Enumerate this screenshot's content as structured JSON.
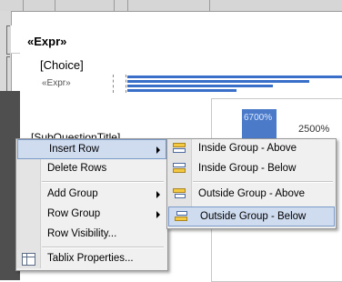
{
  "report": {
    "expr_header": "«Expr»",
    "choice_cell": "[Choice]",
    "detail_expr": "«Expr»",
    "subquestion_title": "[SubQuestionTitle]",
    "chart_label_1": "6700%",
    "chart_label_2": "2500%"
  },
  "context_menu": {
    "items": [
      {
        "label": "Insert Row",
        "has_submenu": true,
        "highlighted": true
      },
      {
        "label": "Delete Rows",
        "has_submenu": false
      },
      {
        "label": "Add Group",
        "has_submenu": true
      },
      {
        "label": "Row Group",
        "has_submenu": true
      },
      {
        "label": "Row Visibility...",
        "has_submenu": false
      },
      {
        "label": "Tablix Properties...",
        "has_submenu": false,
        "icon": "tablix-properties-icon"
      }
    ]
  },
  "insert_row_submenu": {
    "items": [
      {
        "label": "Inside Group - Above",
        "icon": "insert-row-above-icon"
      },
      {
        "label": "Inside Group - Below",
        "icon": "insert-row-below-icon"
      },
      {
        "label": "Outside Group - Above",
        "icon": "insert-row-outside-above-icon"
      },
      {
        "label": "Outside Group - Below",
        "icon": "insert-row-outside-below-icon",
        "highlighted": true
      }
    ]
  },
  "colors": {
    "highlight_bg": "#cfdcef",
    "highlight_border": "#7b9ac8",
    "chart_bar": "#4a7ac8"
  }
}
